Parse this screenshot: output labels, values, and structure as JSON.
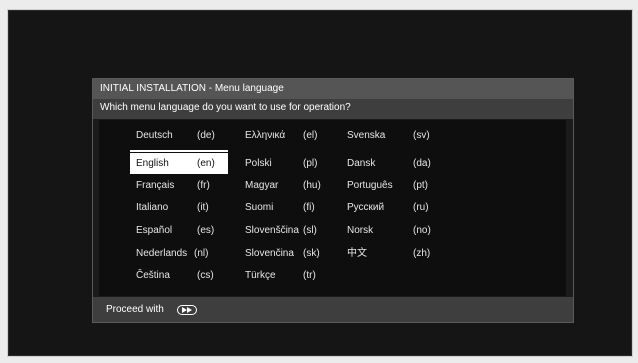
{
  "dialog": {
    "title": "INITIAL INSTALLATION - Menu language",
    "question": "Which menu language do you want to use for operation?",
    "footer_text": "Proceed with",
    "footer_icon": "fast-forward-icon"
  },
  "languages": [
    {
      "name": "Deutsch",
      "code": "(de)"
    },
    {
      "name": "English",
      "code": "(en)",
      "selected": true
    },
    {
      "name": "Français",
      "code": "(fr)"
    },
    {
      "name": "Italiano",
      "code": "(it)"
    },
    {
      "name": "Español",
      "code": "(es)"
    },
    {
      "name": "Nederlands",
      "code": "(nl)"
    },
    {
      "name": "Čeština",
      "code": "(cs)"
    },
    {
      "name": "Ελληνικά",
      "code": "(el)"
    },
    {
      "name": "Polski",
      "code": "(pl)"
    },
    {
      "name": "Magyar",
      "code": "(hu)"
    },
    {
      "name": "Suomi",
      "code": "(fi)"
    },
    {
      "name": "Slovenščina",
      "code": "(sl)"
    },
    {
      "name": "Slovenčina",
      "code": "(sk)"
    },
    {
      "name": "Türkçe",
      "code": "(tr)"
    },
    {
      "name": "Svenska",
      "code": "(sv)"
    },
    {
      "name": "Dansk",
      "code": "(da)"
    },
    {
      "name": "Português",
      "code": "(pt)"
    },
    {
      "name": "Русский",
      "code": "(ru)"
    },
    {
      "name": "Norsk",
      "code": "(no)"
    },
    {
      "name": "中文",
      "code": "(zh)"
    }
  ],
  "colors": {
    "header": "#555555",
    "question_bar": "#3e3e3e",
    "panel": "#0e0e0e",
    "selected": "#ffffff"
  }
}
